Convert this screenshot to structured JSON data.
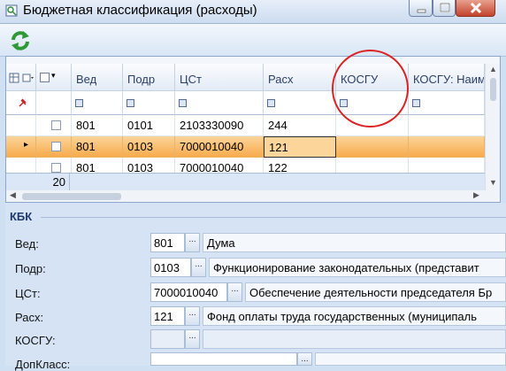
{
  "window": {
    "title": "Бюджетная классификация (расходы)",
    "icons": {
      "app": "search-window-icon",
      "minimize": "minimize-icon",
      "maximize": "maximize-icon",
      "close": "close-icon"
    }
  },
  "toolbar": {
    "refresh_icon": "refresh-icon"
  },
  "grid": {
    "columns": [
      "Вед",
      "Подр",
      "ЦСт",
      "Расх",
      "КОСГУ",
      "КОСГУ: Наим"
    ],
    "rows": [
      {
        "ved": "801",
        "podr": "0101",
        "cst": "2103330090",
        "rash": "244",
        "kosgu": "",
        "selected": false
      },
      {
        "ved": "801",
        "podr": "0103",
        "cst": "7000010040",
        "rash": "121",
        "kosgu": "",
        "selected": true
      },
      {
        "ved": "801",
        "podr": "0103",
        "cst": "7000010040",
        "rash": "122",
        "kosgu": "",
        "selected": false
      }
    ],
    "footer_count": "20"
  },
  "kbk": {
    "title": "КБК",
    "fields": [
      {
        "label": "Вед:",
        "code": "801",
        "desc": "Дума"
      },
      {
        "label": "Подр:",
        "code": "0103",
        "desc": "Функционирование законодательных (представит"
      },
      {
        "label": "ЦСт:",
        "code": "7000010040",
        "desc": "Обеспечение деятельности председателя Бр"
      },
      {
        "label": "Расх:",
        "code": "121",
        "desc": "Фонд оплаты труда государственных (муниципаль"
      },
      {
        "label": "КОСГУ:",
        "code": "",
        "desc": ""
      },
      {
        "label": "ДопКласс:",
        "code": "",
        "desc": ""
      }
    ],
    "button_label": "..."
  },
  "colors": {
    "selection": "#f7a94a",
    "annotation": "#dd2222"
  }
}
